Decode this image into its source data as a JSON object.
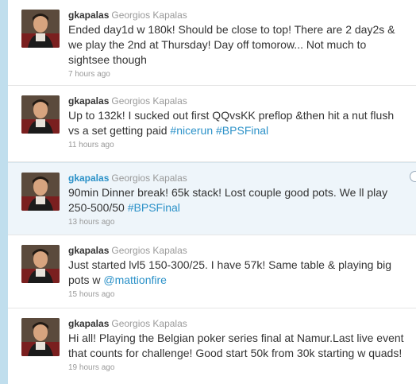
{
  "tweets": [
    {
      "screen_name": "gkapalas",
      "full_name": "Georgios Kapalas",
      "lines": [
        [
          {
            "t": "Ended day1d w 180k! Should be close to top! There are 2 day2s &"
          }
        ],
        [
          {
            "t": "we play the 2nd at Thursday! Day off tomorow... Not much to"
          }
        ],
        [
          {
            "t": "sightsee though"
          }
        ]
      ],
      "time": "7 hours ago",
      "highlight": false
    },
    {
      "screen_name": "gkapalas",
      "full_name": "Georgios Kapalas",
      "lines": [
        [
          {
            "t": "Up to 132k! I sucked out first QQvsKK preflop &then hit a nut flush"
          }
        ],
        [
          {
            "t": "vs a set getting paid "
          },
          {
            "t": "#nicerun",
            "link": true
          },
          {
            "t": " "
          },
          {
            "t": "#BPSFinal",
            "link": true
          }
        ]
      ],
      "time": "11 hours ago",
      "highlight": false
    },
    {
      "screen_name": "gkapalas",
      "full_name": "Georgios Kapalas",
      "lines": [
        [
          {
            "t": "90min Dinner break! 65k stack! Lost couple good pots. We ll play"
          }
        ],
        [
          {
            "t": "250-500/50 "
          },
          {
            "t": "#BPSFinal",
            "link": true
          }
        ]
      ],
      "time": "13 hours ago",
      "highlight": true
    },
    {
      "screen_name": "gkapalas",
      "full_name": "Georgios Kapalas",
      "lines": [
        [
          {
            "t": "Just started lvl5 150-300/25. I have 57k! Same table & playing big"
          }
        ],
        [
          {
            "t": "pots w "
          },
          {
            "t": "@mattionfire",
            "link": true
          }
        ]
      ],
      "time": "15 hours ago",
      "highlight": false
    },
    {
      "screen_name": "gkapalas",
      "full_name": "Georgios Kapalas",
      "lines": [
        [
          {
            "t": "Hi all! Playing the Belgian poker series final at Namur.Last live event"
          }
        ],
        [
          {
            "t": "that counts for challenge! Good start 50k from 30k starting w quads!"
          }
        ]
      ],
      "time": "19 hours ago",
      "highlight": false
    }
  ]
}
